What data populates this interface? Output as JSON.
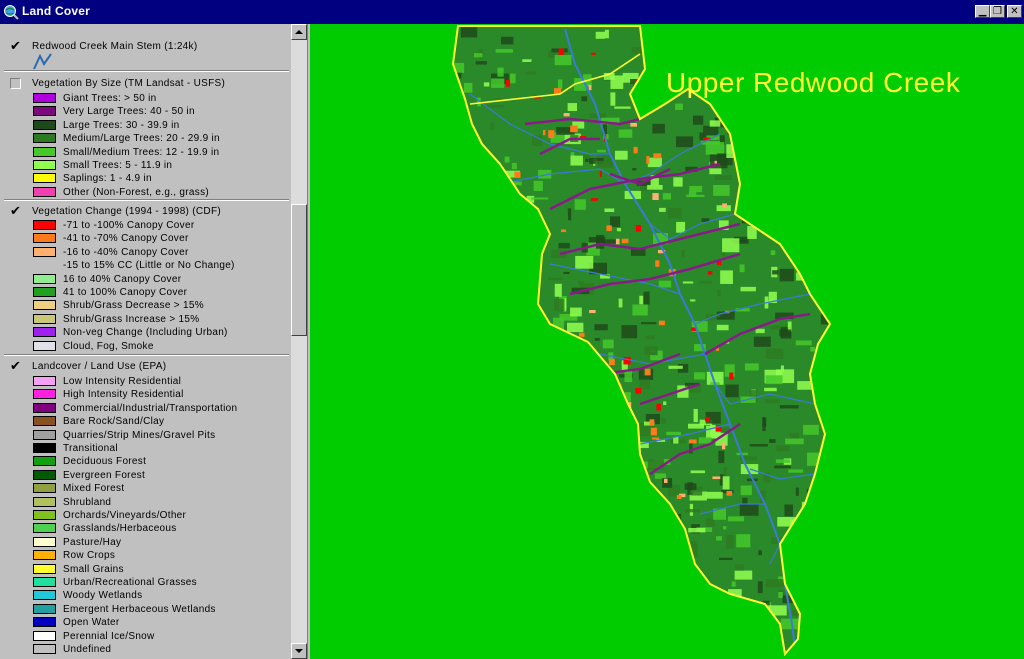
{
  "window": {
    "title": "Land Cover"
  },
  "legend": {
    "groups": [
      {
        "title": "Redwood Creek Main Stem (1:24k)",
        "checked": true,
        "items": []
      },
      {
        "title": "Vegetation By Size (TM Landsat - USFS)",
        "checked": false,
        "items": [
          {
            "label": "Giant Trees: > 50 in",
            "color": "#b000e0"
          },
          {
            "label": "Very Large Trees: 40 - 50 in",
            "color": "#7a0a7a"
          },
          {
            "label": "Large Trees: 30 - 39.9 in",
            "color": "#1e4a1a"
          },
          {
            "label": "Medium/Large Trees: 20 - 29.9 in",
            "color": "#2e7a22"
          },
          {
            "label": "Small/Medium Trees: 12 - 19.9 in",
            "color": "#44c82a"
          },
          {
            "label": "Small Trees: 5 - 11.9 in",
            "color": "#90ff50"
          },
          {
            "label": "Saplings: 1 - 4.9 in",
            "color": "#ffff00"
          },
          {
            "label": "Other (Non-Forest, e.g., grass)",
            "color": "#f040b0"
          }
        ]
      },
      {
        "title": "Vegetation Change (1994 - 1998) (CDF)",
        "checked": true,
        "items": [
          {
            "label": "-71 to -100% Canopy Cover",
            "color": "#ff0000"
          },
          {
            "label": "-41 to -70% Canopy Cover",
            "color": "#ff7a1a"
          },
          {
            "label": "-16 to -40% Canopy Cover",
            "color": "#ffb070"
          },
          {
            "label": "-15 to 15% CC (Little or No Change)",
            "color": ""
          },
          {
            "label": "16 to 40% Canopy Cover",
            "color": "#90ee90"
          },
          {
            "label": "41 to 100% Canopy Cover",
            "color": "#22a022"
          },
          {
            "label": "Shrub/Grass Decrease > 15%",
            "color": "#f0d080"
          },
          {
            "label": "Shrub/Grass Increase > 15%",
            "color": "#c8c878"
          },
          {
            "label": "Non-veg Change (Including Urban)",
            "color": "#a020f0"
          },
          {
            "label": "Cloud, Fog, Smoke",
            "color": "#e0e0e8"
          }
        ]
      },
      {
        "title": "Landcover / Land Use (EPA)",
        "checked": true,
        "items": [
          {
            "label": "Low Intensity Residential",
            "color": "#f5a0f5"
          },
          {
            "label": "High Intensity Residential",
            "color": "#ff20e0"
          },
          {
            "label": "Commercial/Industrial/Transportation",
            "color": "#800080"
          },
          {
            "label": "Bare Rock/Sand/Clay",
            "color": "#8a5020"
          },
          {
            "label": "Quarries/Strip Mines/Gravel Pits",
            "color": "#a0a0a0"
          },
          {
            "label": "Transitional",
            "color": "#000000"
          },
          {
            "label": "Deciduous Forest",
            "color": "#10a010"
          },
          {
            "label": "Evergreen Forest",
            "color": "#005a00"
          },
          {
            "label": "Mixed Forest",
            "color": "#90a040"
          },
          {
            "label": "Shrubland",
            "color": "#b0c060"
          },
          {
            "label": "Orchards/Vineyards/Other",
            "color": "#80c020"
          },
          {
            "label": "Grasslands/Herbaceous",
            "color": "#50d050"
          },
          {
            "label": "Pasture/Hay",
            "color": "#ffffd0"
          },
          {
            "label": "Row Crops",
            "color": "#ffb000"
          },
          {
            "label": "Small Grains",
            "color": "#ffff30"
          },
          {
            "label": "Urban/Recreational Grasses",
            "color": "#20e0a0"
          },
          {
            "label": "Woody Wetlands",
            "color": "#20c8d8"
          },
          {
            "label": "Emergent Herbaceous Wetlands",
            "color": "#20a0a0"
          },
          {
            "label": "Open Water",
            "color": "#0000c0"
          },
          {
            "label": "Perennial Ice/Snow",
            "color": "#ffffff"
          },
          {
            "label": "Undefined",
            "color": "#c0c0c0"
          }
        ]
      }
    ]
  },
  "map": {
    "title": "Upper Redwood Creek",
    "colors": {
      "background": "#00cc00",
      "watershed_fill": "#2a8a2a",
      "boundary": "#ffff33",
      "streams": "#3a7ad8",
      "roads": "#8a1a8a"
    }
  }
}
